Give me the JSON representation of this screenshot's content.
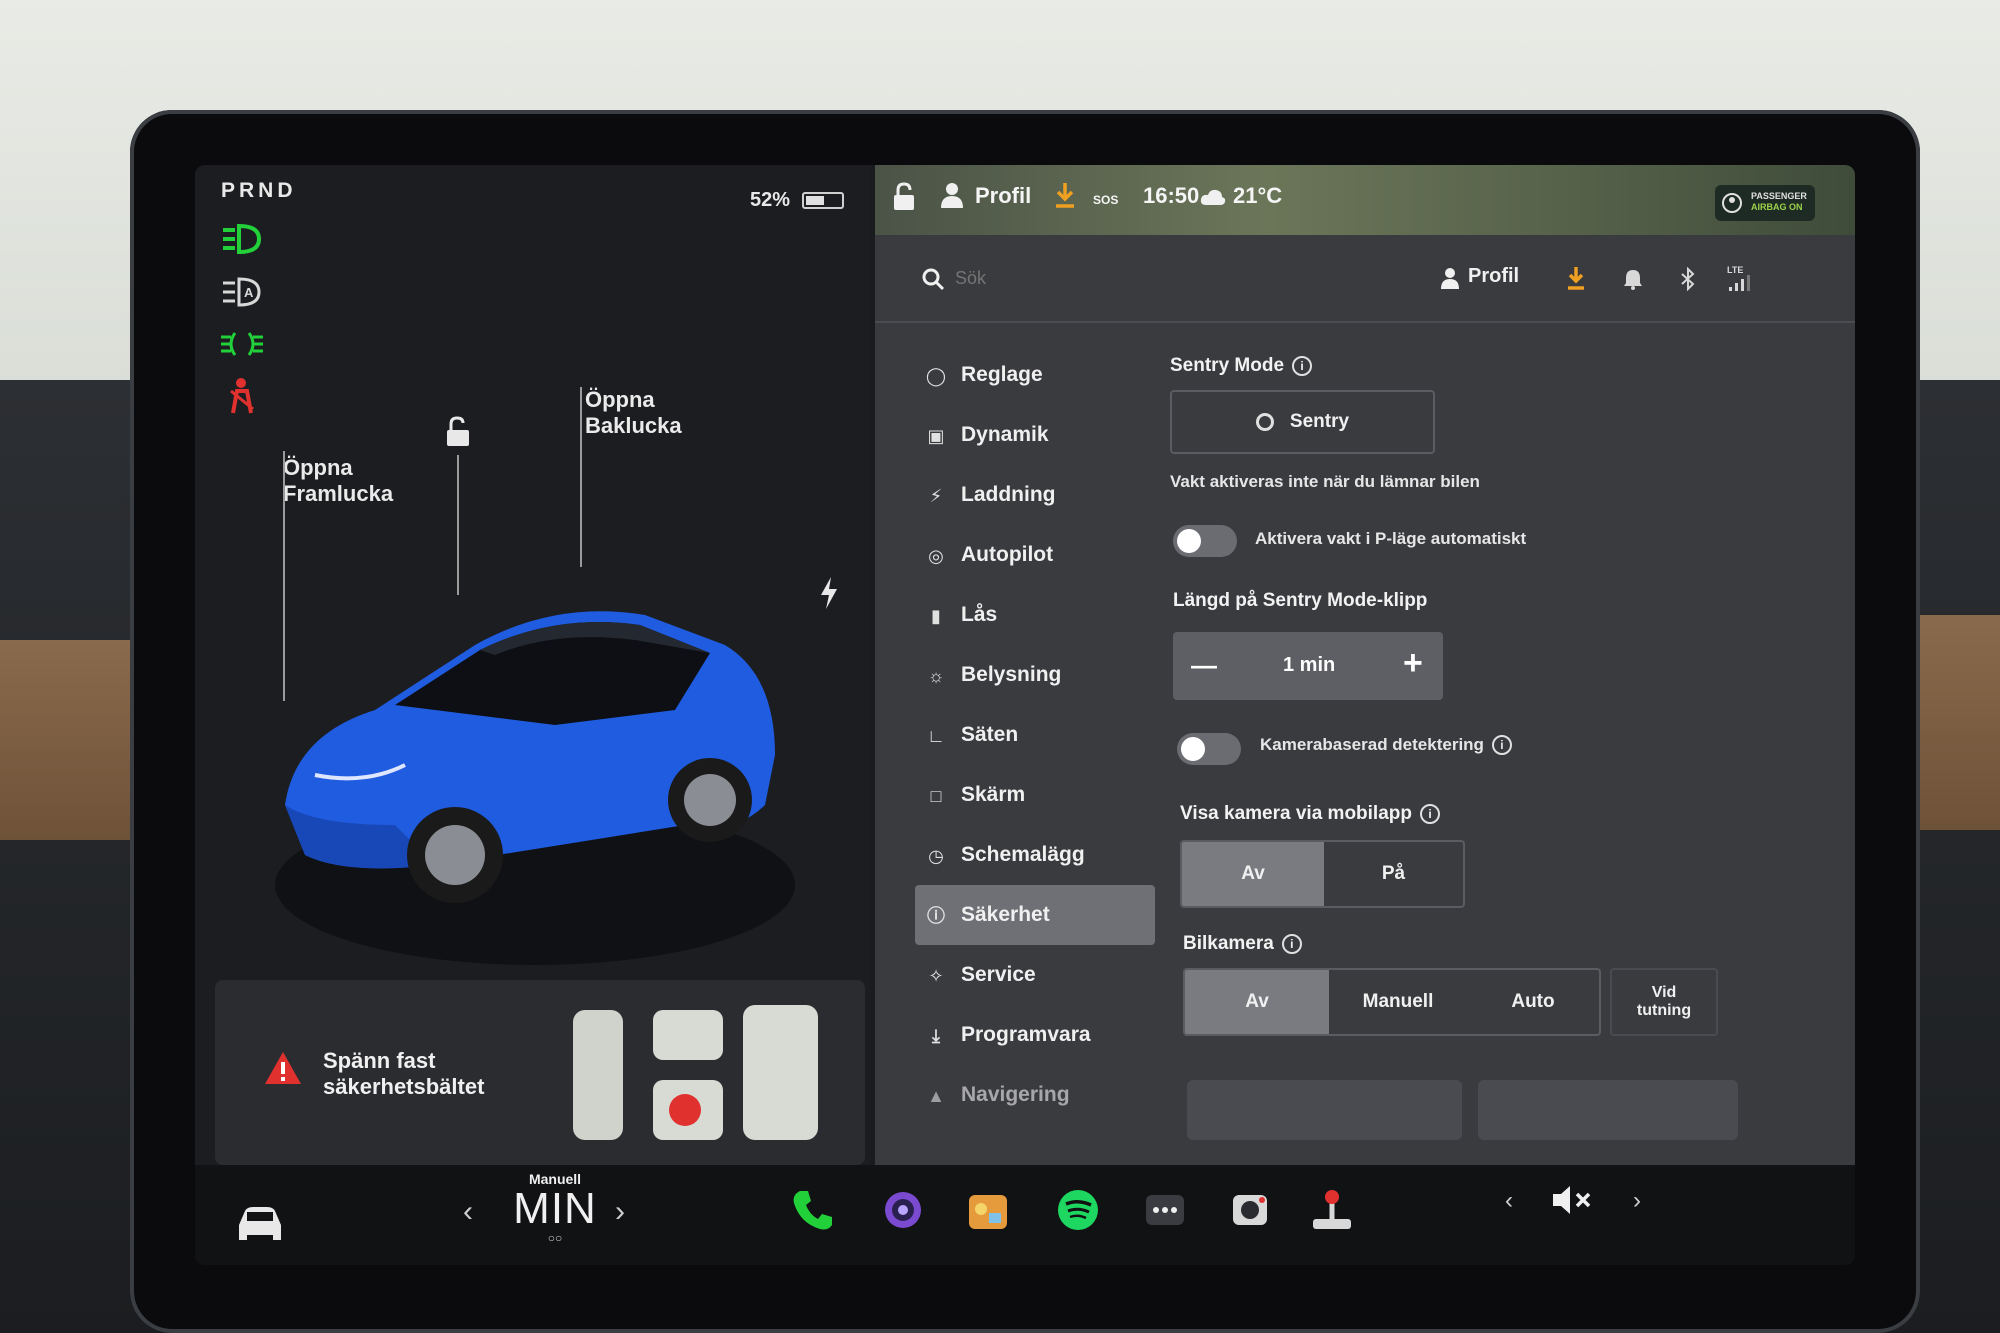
{
  "drive": {
    "gear_indicator": "PRND",
    "battery_percent": "52%",
    "battery_level": 0.52
  },
  "car_view": {
    "annotation_frunk": [
      "Öppna",
      "Framlucka"
    ],
    "annotation_trunk": [
      "Öppna",
      "Baklucka"
    ]
  },
  "seatbelt_alert": {
    "line1": "Spänn fast",
    "line2": "säkerhetsbältet"
  },
  "status_bar": {
    "profile": "Profil",
    "sos": "SOS",
    "time": "16:50",
    "temperature": "21°C",
    "airbag_line1": "PASSENGER",
    "airbag_line2": "AIRBAG ON"
  },
  "search": {
    "placeholder": "Sök",
    "profile_label": "Profil",
    "signal_label": "LTE"
  },
  "menu": {
    "items": [
      {
        "label": "Reglage",
        "icon": "toggle-icon"
      },
      {
        "label": "Dynamik",
        "icon": "car-icon"
      },
      {
        "label": "Laddning",
        "icon": "bolt-icon"
      },
      {
        "label": "Autopilot",
        "icon": "steering-wheel-icon"
      },
      {
        "label": "Lås",
        "icon": "lock-icon"
      },
      {
        "label": "Belysning",
        "icon": "sun-icon"
      },
      {
        "label": "Säten",
        "icon": "seat-icon"
      },
      {
        "label": "Skärm",
        "icon": "display-icon"
      },
      {
        "label": "Schemalägg",
        "icon": "clock-icon"
      },
      {
        "label": "Säkerhet",
        "icon": "info-circle-icon",
        "active": true
      },
      {
        "label": "Service",
        "icon": "wrench-icon"
      },
      {
        "label": "Programvara",
        "icon": "download-icon"
      },
      {
        "label": "Navigering",
        "icon": "navigation-icon"
      }
    ]
  },
  "sentry": {
    "title": "Sentry Mode",
    "button": "Sentry",
    "description": "Vakt aktiveras inte när du lämnar bilen",
    "auto_toggle_label": "Aktivera vakt i P-läge automatiskt",
    "auto_toggle_on": false,
    "clip_length_title": "Längd på Sentry Mode-klipp",
    "clip_length_value": "1 min",
    "camera_detect_label": "Kamerabaserad detektering",
    "camera_detect_on": false,
    "mobile_cam_title": "Visa kamera via mobilapp",
    "mobile_cam_options": [
      "Av",
      "På"
    ],
    "mobile_cam_selected": "Av"
  },
  "dashcam": {
    "title": "Bilkamera",
    "options": [
      "Av",
      "Manuell",
      "Auto"
    ],
    "selected": "Av",
    "extra_option_line1": "Vid",
    "extra_option_line2": "tutning"
  },
  "taskbar": {
    "wiper_mode": "Manuell",
    "wiper_value": "MIN"
  },
  "colors": {
    "accent_blue": "#1f5ce0",
    "indicator_green": "#22d13a",
    "alert_red": "#e0312f",
    "download_orange": "#f0a020"
  }
}
